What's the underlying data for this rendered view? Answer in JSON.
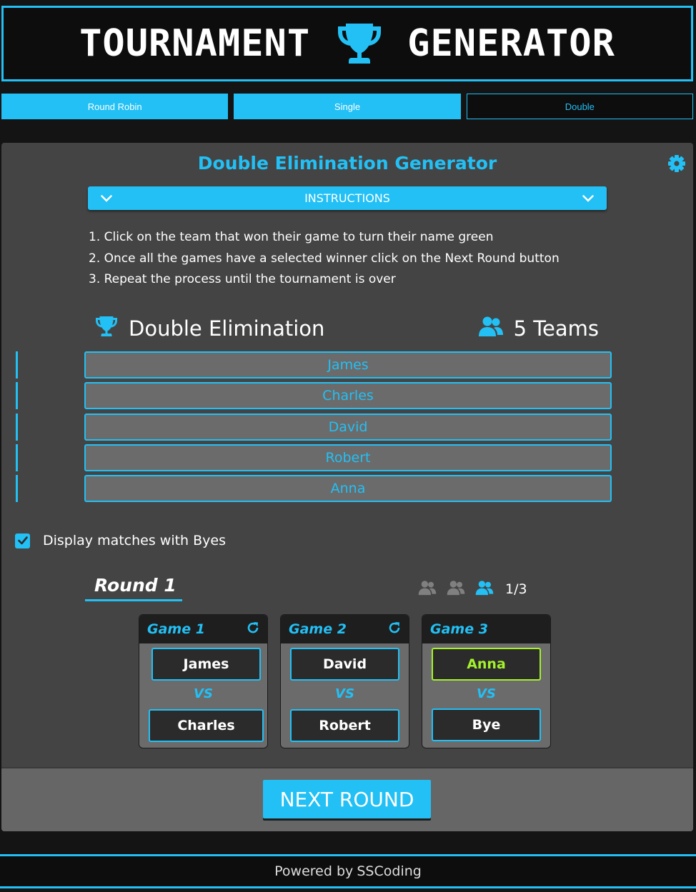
{
  "header": {
    "title_left": "TOURNAMENT",
    "title_right": "GENERATOR",
    "icon": "trophy-icon"
  },
  "tabs": [
    {
      "label": "Round Robin",
      "active": false
    },
    {
      "label": "Single",
      "active": false
    },
    {
      "label": "Double",
      "active": true
    }
  ],
  "panel": {
    "title": "Double Elimination Generator",
    "instructions_label": "INSTRUCTIONS",
    "instructions": [
      "1. Click on the team that won their game to turn their name green",
      "2. Once all the games have a selected winner click on the Next Round button",
      "3. Repeat the process until the tournament is over"
    ],
    "mode_label": "Double Elimination",
    "team_count_label": "5 Teams",
    "teams": [
      "James",
      "Charles",
      "David",
      "Robert",
      "Anna"
    ],
    "bye_checkbox": {
      "label": "Display matches with Byes",
      "checked": true
    }
  },
  "round": {
    "title": "Round 1",
    "page": "1/3",
    "games": [
      {
        "title": "Game 1",
        "team1": "James",
        "vs": "VS",
        "team2": "Charles",
        "winner": null
      },
      {
        "title": "Game 2",
        "team1": "David",
        "vs": "VS",
        "team2": "Robert",
        "winner": null
      },
      {
        "title": "Game 3",
        "team1": "Anna",
        "vs": "VS",
        "team2": "Bye",
        "winner": "team1"
      }
    ]
  },
  "next_button": "NEXT ROUND",
  "footer": {
    "powered_by": "Powered by",
    "brand": "SSCoding"
  },
  "colors": {
    "accent": "#22c0f5",
    "winner": "#a4f22b",
    "panel": "#444444"
  }
}
